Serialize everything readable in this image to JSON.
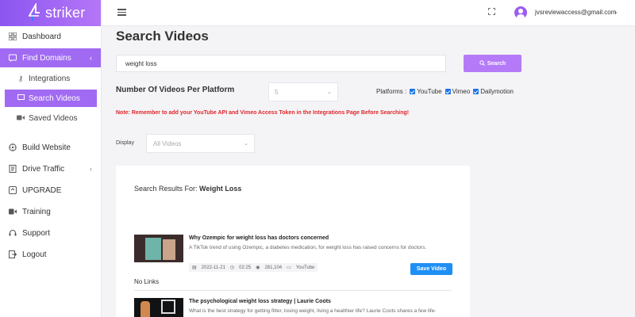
{
  "brand": {
    "name": "striker"
  },
  "sidebar": {
    "items": [
      {
        "label": "Dashboard",
        "icon": "dashboard-icon"
      },
      {
        "label": "Find Domains",
        "icon": "find-domains-icon",
        "active": true
      },
      {
        "label": "Build Website",
        "icon": "build-website-icon"
      },
      {
        "label": "Drive Traffic",
        "icon": "drive-traffic-icon"
      },
      {
        "label": "UPGRADE",
        "icon": "upgrade-icon"
      },
      {
        "label": "Training",
        "icon": "training-icon"
      },
      {
        "label": "Support",
        "icon": "support-icon"
      },
      {
        "label": "Logout",
        "icon": "logout-icon"
      }
    ],
    "subitems": [
      {
        "label": "Integrations",
        "icon": "key-icon"
      },
      {
        "label": "Search Videos",
        "icon": "video-icon",
        "active": true
      },
      {
        "label": "Saved Videos",
        "icon": "video-icon"
      }
    ]
  },
  "topbar": {
    "user_email": "jvsreviewaccess@gmail.com"
  },
  "page": {
    "title": "Search Videos"
  },
  "search": {
    "value": "weight loss",
    "button_label": "Search"
  },
  "videos_per_platform": {
    "label": "Number Of Videos Per Platform",
    "value": "5"
  },
  "platforms": {
    "label": "Platforms :",
    "options": [
      {
        "label": "YouTube",
        "checked": true
      },
      {
        "label": "Vimeo",
        "checked": true
      },
      {
        "label": "Dailymotion",
        "checked": true
      }
    ]
  },
  "note": "Note: Remember to add your YouTube API and Vimeo Access Token in the Integrations Page Before Searching!",
  "display": {
    "label": "Display",
    "value": "All Videos"
  },
  "results": {
    "prefix": "Search Results For:",
    "query": "Weight Loss",
    "items": [
      {
        "title": "Why Ozempic for weight loss has doctors concerned",
        "description": "A TikTok trend of using Ozempic, a diabetes medication, for weight loss has raised concerns for doctors.",
        "date": "2022-11-21",
        "duration": "02:25",
        "views": "281,104",
        "platform": "YouTube",
        "save_label": "Save Video",
        "links_text": "No Links"
      },
      {
        "title": "The psychological weight loss strategy | Laurie Coots",
        "description": "What is the best strategy for getting fitter, losing weight, living a healthier life? Laurie Coots shares a few life-"
      }
    ]
  }
}
